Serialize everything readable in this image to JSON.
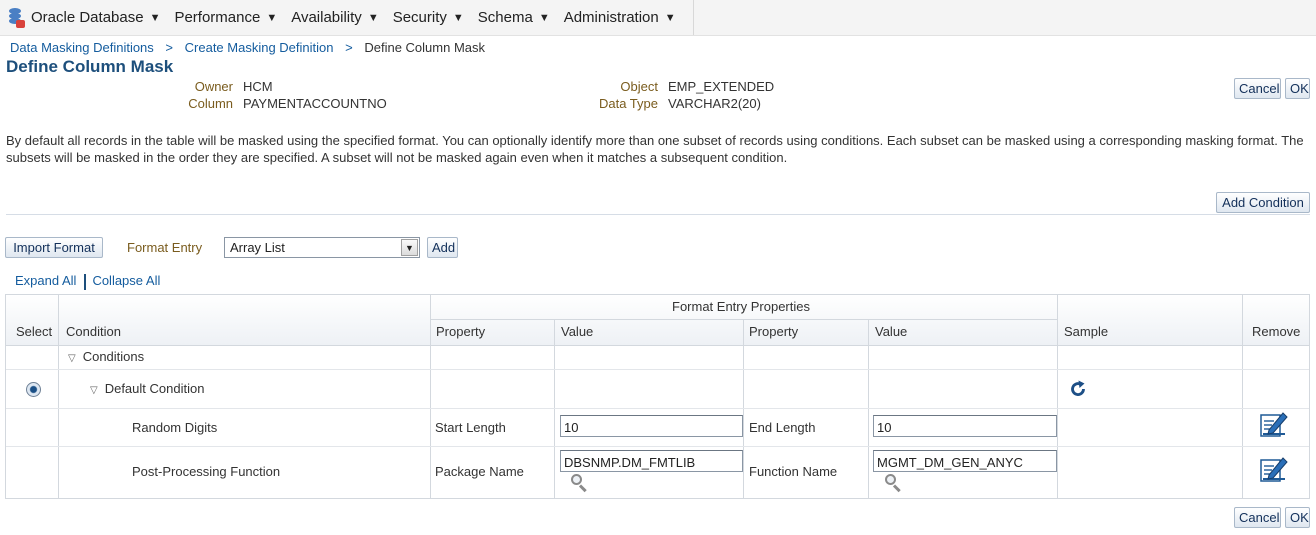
{
  "menu": {
    "items": [
      {
        "label": "Oracle Database"
      },
      {
        "label": "Performance"
      },
      {
        "label": "Availability"
      },
      {
        "label": "Security"
      },
      {
        "label": "Schema"
      },
      {
        "label": "Administration"
      }
    ],
    "caret": "▼"
  },
  "breadcrumb": {
    "items": [
      "Data Masking Definitions",
      "Create Masking Definition"
    ],
    "separator": ">",
    "current": "Define Column Mask"
  },
  "page": {
    "title": "Define Column Mask"
  },
  "info": {
    "owner_label": "Owner",
    "owner_value": "HCM",
    "column_label": "Column",
    "column_value": "PAYMENTACCOUNTNO",
    "object_label": "Object",
    "object_value": "EMP_EXTENDED",
    "datatype_label": "Data Type",
    "datatype_value": "VARCHAR2(20)"
  },
  "buttons": {
    "cancel": "Cancel",
    "ok": "OK",
    "add_condition": "Add Condition",
    "import_format": "Import Format",
    "add": "Add"
  },
  "description": "By default all records in the table will be masked using the specified format. You can optionally identify more than one subset of records using conditions. Each subset can be masked using a corresponding masking format. The subsets will be masked in the order they are specified. A subset will not be masked again even when it matches a subsequent condition.",
  "format_entry": {
    "label": "Format Entry",
    "selected": "Array List"
  },
  "links": {
    "expand_all": "Expand All",
    "collapse_all": "Collapse All"
  },
  "table": {
    "group_header": "Format Entry Properties",
    "headers": {
      "select": "Select",
      "condition": "Condition",
      "property1": "Property",
      "value1": "Value",
      "property2": "Property",
      "value2": "Value",
      "sample": "Sample",
      "remove": "Remove"
    },
    "rows": {
      "conditions": "Conditions",
      "default_condition": "Default Condition",
      "random_digits": {
        "name": "Random Digits",
        "prop1": "Start Length",
        "val1": "10",
        "prop2": "End Length",
        "val2": "10"
      },
      "post_processing": {
        "name": "Post-Processing Function",
        "prop1": "Package Name",
        "val1": "DBSNMP.DM_FMTLIB",
        "prop2": "Function Name",
        "val2": "MGMT_DM_GEN_ANYC"
      }
    }
  },
  "icons": {
    "refresh": "refresh-icon",
    "edit": "edit-icon",
    "search": "search-icon",
    "database": "database-icon",
    "expand": "triangle-down-icon"
  },
  "colors": {
    "link": "#145c9e",
    "title": "#1d4f7c",
    "label": "#7a5c1e",
    "button_text": "#13305a"
  }
}
